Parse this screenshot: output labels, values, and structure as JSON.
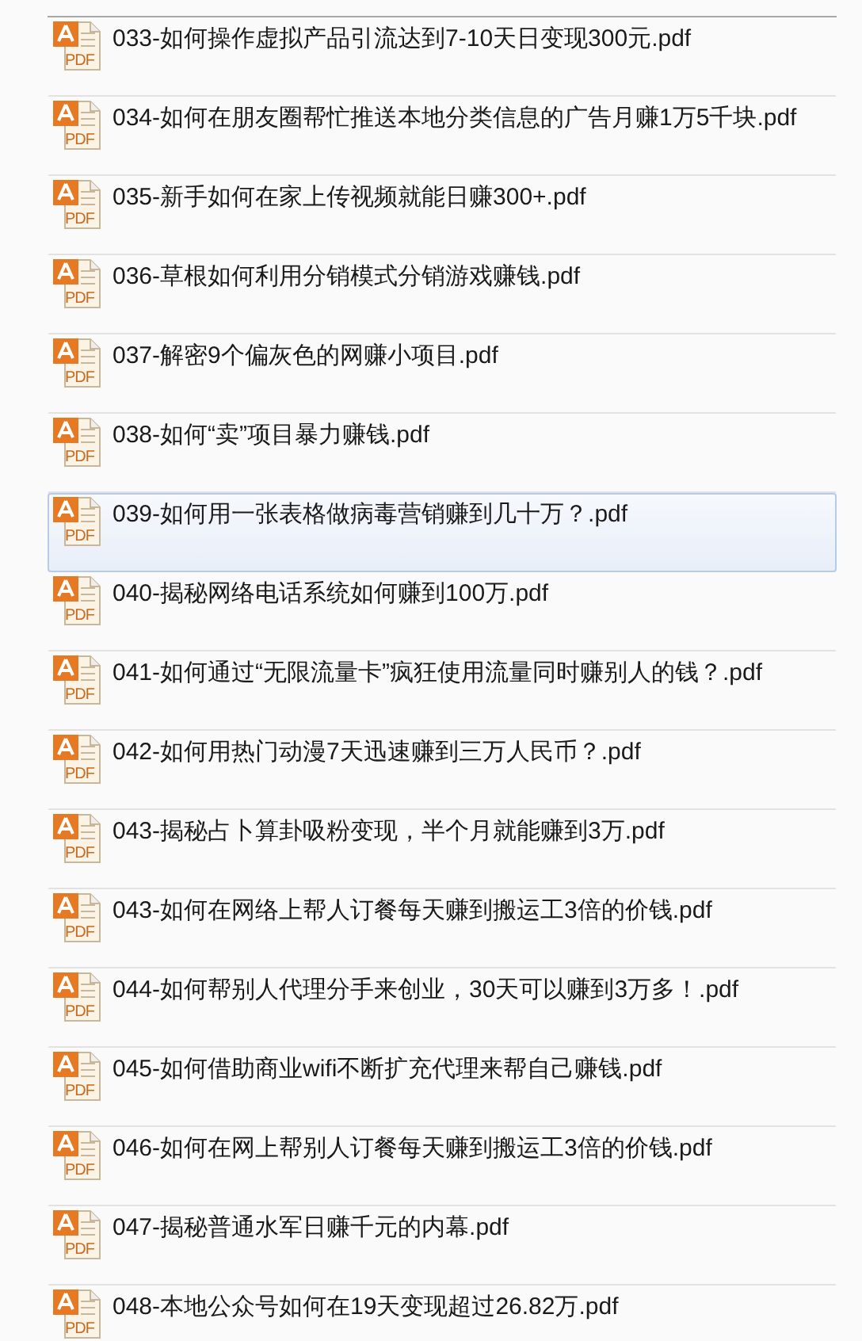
{
  "files": [
    {
      "name": "033-如何操作虚拟产品引流达到7-10天日变现300元.pdf",
      "icon_text": "PDF",
      "selected": false
    },
    {
      "name": "034-如何在朋友圈帮忙推送本地分类信息的广告月赚1万5千块.pdf",
      "icon_text": "PDF",
      "selected": false
    },
    {
      "name": "035-新手如何在家上传视频就能日赚300+.pdf",
      "icon_text": "PDF",
      "selected": false
    },
    {
      "name": "036-草根如何利用分销模式分销游戏赚钱.pdf",
      "icon_text": "PDF",
      "selected": false
    },
    {
      "name": "037-解密9个偏灰色的网赚小项目.pdf",
      "icon_text": "PDF",
      "selected": false
    },
    {
      "name": "038-如何“卖”项目暴力赚钱.pdf",
      "icon_text": "PDF",
      "selected": false
    },
    {
      "name": "039-如何用一张表格做病毒营销赚到几十万？.pdf",
      "icon_text": "PDF",
      "selected": true
    },
    {
      "name": "040-揭秘网络电话系统如何赚到100万.pdf",
      "icon_text": "PDF",
      "selected": false
    },
    {
      "name": "041-如何通过“无限流量卡”疯狂使用流量同时赚别人的钱？.pdf",
      "icon_text": "PDF",
      "selected": false
    },
    {
      "name": "042-如何用热门动漫7天迅速赚到三万人民币？.pdf",
      "icon_text": "PDF",
      "selected": false
    },
    {
      "name": "043-揭秘占卜算卦吸粉变现，半个月就能赚到3万.pdf",
      "icon_text": "PDF",
      "selected": false
    },
    {
      "name": "043-如何在网络上帮人订餐每天赚到搬运工3倍的价钱.pdf",
      "icon_text": "PDF",
      "selected": false
    },
    {
      "name": "044-如何帮别人代理分手来创业，30天可以赚到3万多！.pdf",
      "icon_text": "PDF",
      "selected": false
    },
    {
      "name": "045-如何借助商业wifi不断扩充代理来帮自己赚钱.pdf",
      "icon_text": "PDF",
      "selected": false
    },
    {
      "name": "046-如何在网上帮别人订餐每天赚到搬运工3倍的价钱.pdf",
      "icon_text": "PDF",
      "selected": false
    },
    {
      "name": "047-揭秘普通水军日赚千元的内幕.pdf",
      "icon_text": "PDF",
      "selected": false
    },
    {
      "name": "048-本地公众号如何在19天变现超过26.82万.pdf",
      "icon_text": "PDF",
      "selected": false
    }
  ]
}
